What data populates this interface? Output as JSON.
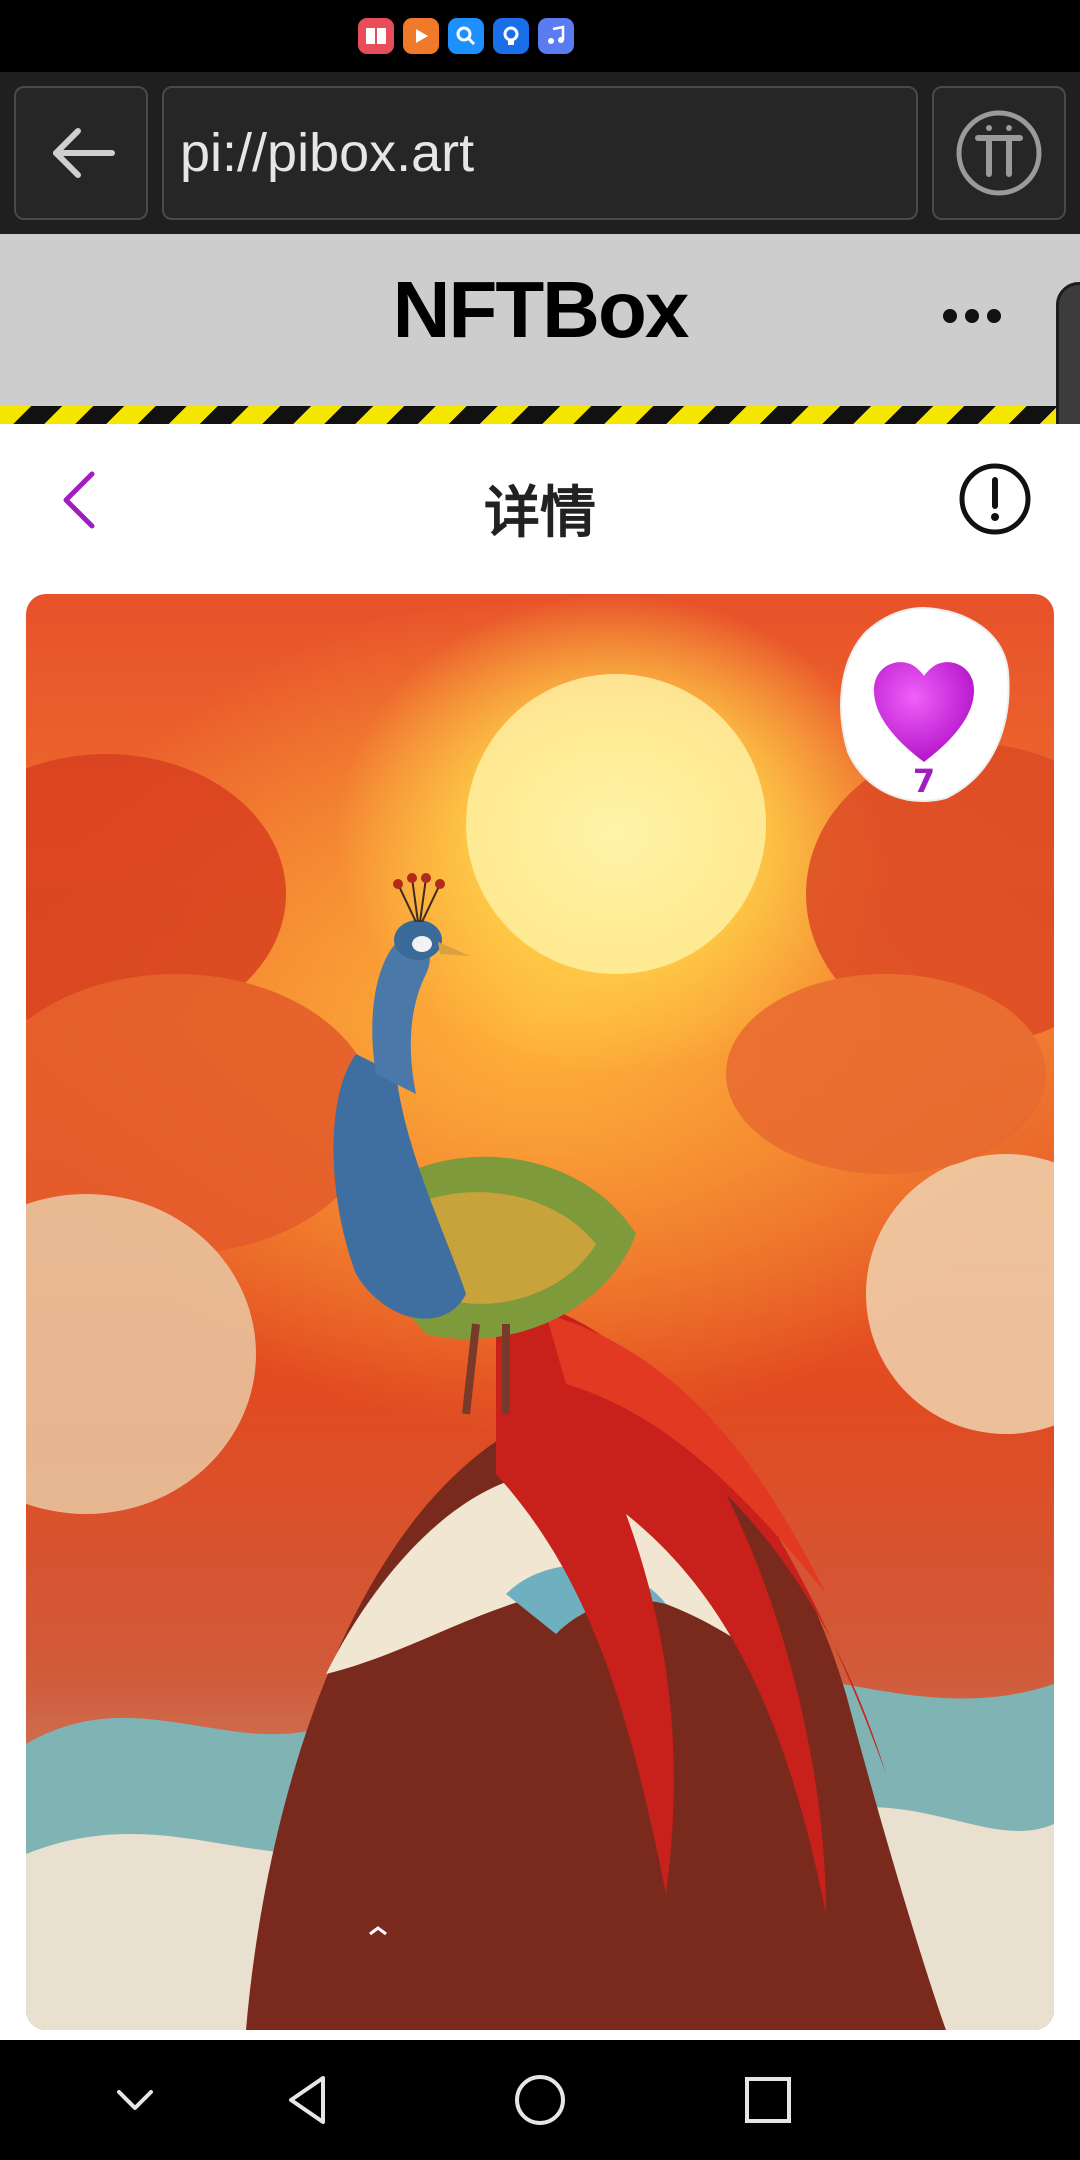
{
  "status_bar": {
    "icons": [
      {
        "name": "books-icon",
        "color": "#e84d5a"
      },
      {
        "name": "video-icon",
        "color": "#f07a2a"
      },
      {
        "name": "search-app-icon",
        "color": "#1e8fff"
      },
      {
        "name": "tips-icon",
        "color": "#1a6ee8"
      },
      {
        "name": "music-icon",
        "color": "#5a7cf0"
      }
    ]
  },
  "browser": {
    "url": "pi://pibox.art",
    "back_icon": "arrow-left-icon",
    "pi_icon": "pi-logo-icon"
  },
  "app": {
    "title": "NFTBox",
    "more_icon": "more-horizontal-icon"
  },
  "detail": {
    "title": "详情",
    "back_icon": "chevron-left-icon",
    "info_icon": "exclamation-circle-icon"
  },
  "artwork": {
    "subject": "peacock-phoenix-painting",
    "like_count": "7",
    "like_icon": "heart-icon",
    "like_color": "#c81ed8"
  },
  "system_nav": {
    "items": [
      "collapse-icon",
      "back-triangle-icon",
      "home-circle-icon",
      "recents-square-icon"
    ]
  },
  "colors": {
    "accent": "#a21dbf",
    "header_bg": "#cdcdcd",
    "hazard_yellow": "#f5e600"
  }
}
